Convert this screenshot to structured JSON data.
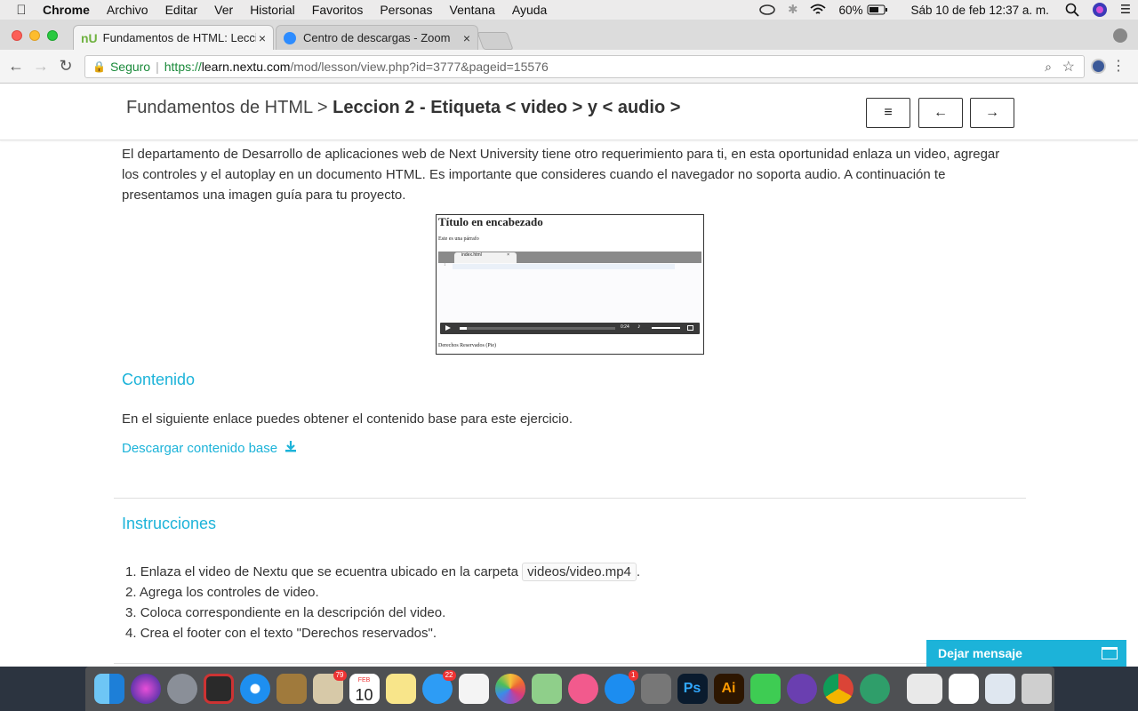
{
  "menubar": {
    "app": "Chrome",
    "items": [
      "Archivo",
      "Editar",
      "Ver",
      "Historial",
      "Favoritos",
      "Personas",
      "Ventana",
      "Ayuda"
    ],
    "battery": "60%",
    "clock": "Sáb 10 de feb  12:37 a. m."
  },
  "tabs": [
    {
      "title": "Fundamentos de HTML: Leccio",
      "close": "×"
    },
    {
      "title": "Centro de descargas - Zoom",
      "close": "×"
    }
  ],
  "toolbar": {
    "secure_label": "Seguro",
    "url_scheme": "https://",
    "url_host": "learn.nextu.com",
    "url_path": "/mod/lesson/view.php?id=3777&pageid=15576"
  },
  "lesson": {
    "breadcrumb_root": "Fundamentos de HTML",
    "breadcrumb_sep": ">",
    "breadcrumb_current": "Leccion 2 - Etiqueta < video > y < audio >",
    "menu_glyph": "≡",
    "prev_glyph": "←",
    "next_glyph": "→"
  },
  "intro": "El departamento de Desarrollo de aplicaciones web de Next University tiene otro requerimiento para ti, en esta oportunidad enlaza un video, agregar los controles y el autoplay en un documento HTML. Es importante que consideres cuando el navegador no soporta audio. A continuación te presentamos una imagen guía para tu proyecto.",
  "guide_image": {
    "title": "Título en encabezado",
    "paragraph": "Este es una párrafo",
    "tab_file": "index.html",
    "tab_close": "×",
    "line_no": "1",
    "time": "0:24",
    "footer": "Derechos Reservados (Pie)"
  },
  "contenido": {
    "heading": "Contenido",
    "text": "En el siguiente enlace puedes obtener el contenido base para este ejercicio.",
    "download_link": "Descargar contenido base"
  },
  "instrucciones": {
    "heading": "Instrucciones",
    "items": [
      {
        "n": "1.",
        "text": "Enlaza el video de Nextu que se ecuentra ubicado en la carpeta",
        "code": "videos/video.mp4",
        "after": "."
      },
      {
        "n": "2.",
        "text": "Agrega los controles de video."
      },
      {
        "n": "3.",
        "text": "Coloca correspondiente en la descripción del video."
      },
      {
        "n": "4.",
        "text": "Crea el footer con el texto \"Derechos reservados\"."
      }
    ]
  },
  "chat": {
    "label": "Dejar mensaje"
  },
  "dock": {
    "badges": {
      "mail": "79",
      "calendar_day": "10",
      "calendar_month": "FEB",
      "messages": "22",
      "appstore": "1"
    },
    "icons": [
      "finder-icon",
      "siri-icon",
      "launchpad-icon",
      "photo-booth-icon",
      "safari-icon",
      "notes-brown-icon",
      "mail-icon",
      "calendar-icon",
      "notes-icon",
      "messages-icon",
      "reminders-icon",
      "photos-icon",
      "maps-icon",
      "itunes-icon",
      "app-store-icon",
      "system-preferences-icon",
      "photoshop-icon",
      "illustrator-icon",
      "facetime-icon",
      "github-icon",
      "chrome-icon",
      "atom-icon",
      "window-preview-icon",
      "paw-icon",
      "folder-icon",
      "trash-icon"
    ]
  },
  "colors": {
    "accent": "#1cb3d9",
    "secure": "#1a8a3a"
  }
}
